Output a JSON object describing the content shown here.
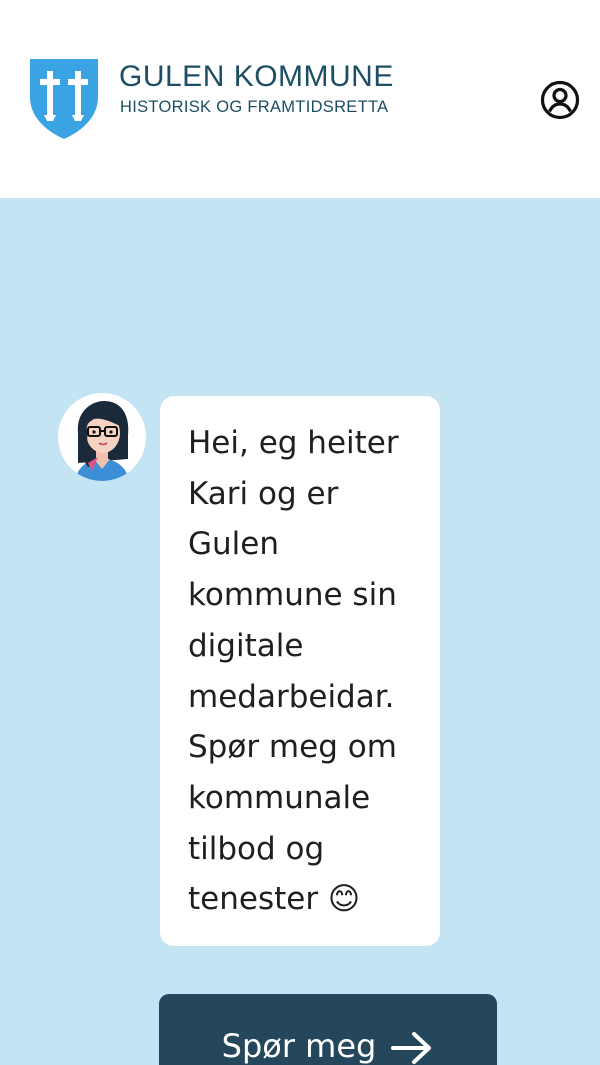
{
  "header": {
    "brand_title": "GULEN KOMMUNE",
    "brand_subtitle": "HISTORISK OG FRAMTIDSRETTA",
    "logo_icon": "coat-of-arms-crosses",
    "profile_icon": "user-circle-icon"
  },
  "chat": {
    "bot_avatar_icon": "assistant-avatar",
    "message": "Hei, eg heiter Kari og er Gulen kommune sin digitale medarbeidar. Spør meg om kommunale tilbod og tenester 😊"
  },
  "cta": {
    "label": "Spør meg",
    "arrow_icon": "arrow-right-icon"
  },
  "colors": {
    "background": "#c4e4f4",
    "brand_blue": "#1d4e63",
    "shield_blue": "#3aa3e3",
    "button": "#24475b"
  }
}
